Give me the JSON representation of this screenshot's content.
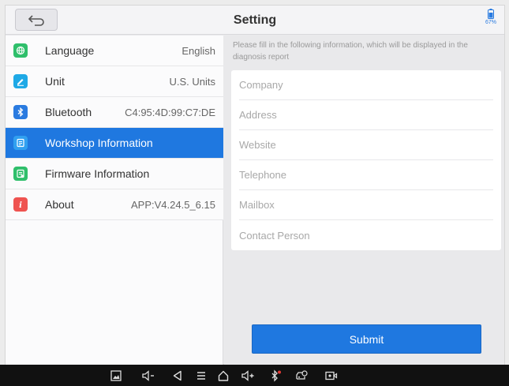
{
  "header": {
    "title": "Setting",
    "battery": "67%"
  },
  "sidebar": {
    "items": [
      {
        "label": "Language",
        "value": "English",
        "icon": "globe-icon",
        "color": "#2fbf6b"
      },
      {
        "label": "Unit",
        "value": "U.S. Units",
        "icon": "edit-icon",
        "color": "#1ea9e6"
      },
      {
        "label": "Bluetooth",
        "value": "C4:95:4D:99:C7:DE",
        "icon": "bluetooth-icon",
        "color": "#2a7be0"
      },
      {
        "label": "Workshop Information",
        "value": "",
        "icon": "document-icon",
        "color": "#31a0f0",
        "active": true
      },
      {
        "label": "Firmware Information",
        "value": "",
        "icon": "firmware-icon",
        "color": "#2fbf6b"
      },
      {
        "label": "About",
        "value": "APP:V4.24.5_6.15",
        "icon": "info-icon",
        "color": "#ef5350"
      }
    ]
  },
  "form": {
    "hint": "Please fill in the following information, which will be displayed in the diagnosis report",
    "fields": [
      {
        "placeholder": "Company",
        "value": ""
      },
      {
        "placeholder": "Address",
        "value": ""
      },
      {
        "placeholder": "Website",
        "value": ""
      },
      {
        "placeholder": "Telephone",
        "value": ""
      },
      {
        "placeholder": "Mailbox",
        "value": ""
      },
      {
        "placeholder": "Contact Person",
        "value": ""
      }
    ],
    "submit_label": "Submit"
  },
  "colors": {
    "accent": "#1f78e0",
    "navbar": "#111111"
  },
  "navbar": {
    "icons": [
      "gallery-icon",
      "volume-down-icon",
      "back-icon",
      "menu-icon",
      "home-icon",
      "volume-up-icon",
      "bluetooth-status-icon",
      "vci-icon",
      "screen-record-icon"
    ]
  }
}
